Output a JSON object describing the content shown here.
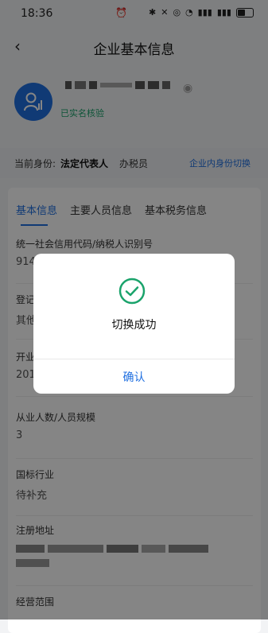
{
  "status_bar": {
    "time": "18:36",
    "icons": [
      "alarm-icon",
      "bluetooth-icon",
      "mute-icon",
      "nfc-icon",
      "wifi-icon",
      "signal-4g-icon",
      "signal-4g-icon",
      "battery-icon"
    ]
  },
  "navbar": {
    "title": "企业基本信息"
  },
  "profile": {
    "verified_text": "已实名核验"
  },
  "identity": {
    "label": "当前身份:",
    "role_legal": "法定代表人",
    "role_tax": "办税员",
    "switch_label": "企业内身份切换"
  },
  "tabs": [
    {
      "label": "基本信息",
      "active": true
    },
    {
      "label": "主要人员信息",
      "active": false
    },
    {
      "label": "基本税务信息",
      "active": false
    }
  ],
  "fields": [
    {
      "label": "统一社会信用代码/纳税人识别号",
      "value": "914"
    },
    {
      "label": "登记",
      "value": "其他"
    },
    {
      "label": "开业",
      "value": "201"
    },
    {
      "label": "从业人数/人员规模",
      "value": "3"
    },
    {
      "label": "国标行业",
      "value": "待补充"
    },
    {
      "label": "注册地址",
      "value": ""
    },
    {
      "label": "经营范围",
      "value": ""
    }
  ],
  "dialog": {
    "message": "切换成功",
    "confirm_label": "确认",
    "accent": "#1aa36b"
  },
  "colors": {
    "primary": "#1f6fe0",
    "verified": "#1aa36b"
  }
}
